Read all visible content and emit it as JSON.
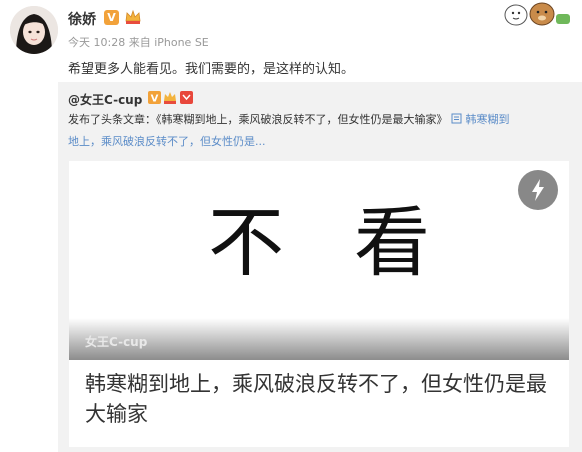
{
  "post": {
    "username": "徐娇",
    "v_badge": "V",
    "timestamp": "今天 10:28",
    "source": "来自 iPhone SE",
    "text": "希望更多人能看见。我们需要的，是这样的认知。"
  },
  "repost": {
    "username": "@女王C-cup",
    "line1_prefix": "发布了头条文章：《韩寒糊到地上，乘风破浪反转不了，但女性仍是最大输家》",
    "line1_link": "韩寒糊到",
    "line2_link": "地上，乘风破浪反转不了，但女性仍是..."
  },
  "article": {
    "cover_chars": "不看",
    "watermark": "女王C-cup",
    "title": "韩寒糊到地上，乘风破浪反转不了，但女性仍是最大输家"
  },
  "icons": {
    "avatar": "avatar",
    "sticker": "cartoon-characters-sticker",
    "lightning": "lightning-icon",
    "article_link": "article-icon"
  },
  "colors": {
    "link": "#5b8cc8",
    "repost_bg": "#f2f2f2",
    "v_badge": "#f2a23a"
  }
}
